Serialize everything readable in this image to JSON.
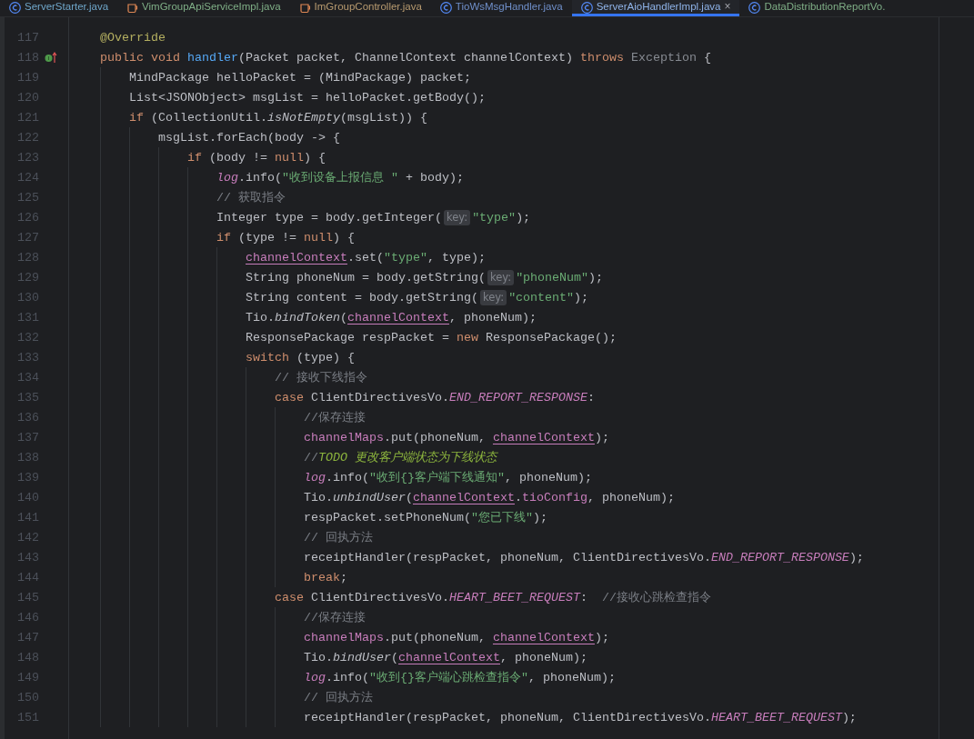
{
  "tabs": [
    {
      "label": "ServerStarter.java",
      "kind": "class",
      "color": "#6fa6c9",
      "selected": false
    },
    {
      "label": "VimGroupApiServiceImpl.java",
      "kind": "bean",
      "color": "#7fae86",
      "selected": false
    },
    {
      "label": "ImGroupController.java",
      "kind": "bean",
      "color": "#b79a6f",
      "selected": false
    },
    {
      "label": "TioWsMsgHandler.java",
      "kind": "class",
      "color": "#6f8fc9",
      "selected": false
    },
    {
      "label": "ServerAioHandlerImpl.java",
      "kind": "class",
      "color": "#8fb3e8",
      "selected": true,
      "close": "×"
    },
    {
      "label": "DataDistributionReportVo.",
      "kind": "class",
      "color": "#7fae86",
      "selected": false
    }
  ],
  "lines": [
    {
      "number": "117",
      "tokens": [
        {
          "kind": "a",
          "text": "@Override"
        }
      ]
    },
    {
      "number": "118",
      "marker": {
        "kind": "implements"
      },
      "tokens": [
        {
          "kind": "k",
          "text": "public void "
        },
        {
          "kind": "m",
          "text": "handler"
        },
        {
          "kind": "p",
          "text": "(Packet packet, ChannelContext channelContext) "
        },
        {
          "kind": "k",
          "text": "throws "
        },
        {
          "kind": "d",
          "text": "Exception"
        },
        {
          "kind": "p",
          "text": " {"
        }
      ],
      "children": [
        {
          "number": "119",
          "tokens": [
            {
              "kind": "p",
              "text": "MindPackage helloPacket = (MindPackage) packet;"
            }
          ]
        },
        {
          "number": "120",
          "tokens": [
            {
              "kind": "p",
              "text": "List<JSONObject> msgList = helloPacket.getBody();"
            }
          ]
        },
        {
          "number": "121",
          "tokens": [
            {
              "kind": "k",
              "text": "if "
            },
            {
              "kind": "p",
              "text": "(CollectionUtil."
            },
            {
              "kind": "sm",
              "text": "isNotEmpty"
            },
            {
              "kind": "p",
              "text": "(msgList)) {"
            }
          ],
          "children": [
            {
              "number": "122",
              "tokens": [
                {
                  "kind": "p",
                  "text": "msgList.forEach(body -> {"
                }
              ],
              "children": [
                {
                  "number": "123",
                  "tokens": [
                    {
                      "kind": "k",
                      "text": "if "
                    },
                    {
                      "kind": "p",
                      "text": "(body != "
                    },
                    {
                      "kind": "k",
                      "text": "null"
                    },
                    {
                      "kind": "p",
                      "text": ") {"
                    }
                  ],
                  "children": [
                    {
                      "number": "124",
                      "tokens": [
                        {
                          "kind": "sf",
                          "text": "log"
                        },
                        {
                          "kind": "p",
                          "text": ".info("
                        },
                        {
                          "kind": "s",
                          "text": "\"收到设备上报信息 \""
                        },
                        {
                          "kind": "p",
                          "text": " + body);"
                        }
                      ]
                    },
                    {
                      "number": "125",
                      "tokens": [
                        {
                          "kind": "c",
                          "text": "// 获取指令"
                        }
                      ]
                    },
                    {
                      "number": "126",
                      "tokens": [
                        {
                          "kind": "p",
                          "text": "Integer type = body.getInteger("
                        },
                        {
                          "kind": "h",
                          "text": "key:"
                        },
                        {
                          "kind": "s",
                          "text": "\"type\""
                        },
                        {
                          "kind": "p",
                          "text": ");"
                        }
                      ]
                    },
                    {
                      "number": "127",
                      "tokens": [
                        {
                          "kind": "k",
                          "text": "if "
                        },
                        {
                          "kind": "p",
                          "text": "(type != "
                        },
                        {
                          "kind": "k",
                          "text": "null"
                        },
                        {
                          "kind": "p",
                          "text": ") {"
                        }
                      ],
                      "children": [
                        {
                          "number": "128",
                          "tokens": [
                            {
                              "kind": "u",
                              "text": "channelContext"
                            },
                            {
                              "kind": "p",
                              "text": ".set("
                            },
                            {
                              "kind": "s",
                              "text": "\"type\""
                            },
                            {
                              "kind": "p",
                              "text": ", type);"
                            }
                          ]
                        },
                        {
                          "number": "129",
                          "tokens": [
                            {
                              "kind": "p",
                              "text": "String phoneNum = body.getString("
                            },
                            {
                              "kind": "h",
                              "text": "key:"
                            },
                            {
                              "kind": "s",
                              "text": "\"phoneNum\""
                            },
                            {
                              "kind": "p",
                              "text": ");"
                            }
                          ]
                        },
                        {
                          "number": "130",
                          "tokens": [
                            {
                              "kind": "p",
                              "text": "String content = body.getString("
                            },
                            {
                              "kind": "h",
                              "text": "key:"
                            },
                            {
                              "kind": "s",
                              "text": "\"content\""
                            },
                            {
                              "kind": "p",
                              "text": ");"
                            }
                          ]
                        },
                        {
                          "number": "131",
                          "tokens": [
                            {
                              "kind": "p",
                              "text": "Tio."
                            },
                            {
                              "kind": "sm",
                              "text": "bindToken"
                            },
                            {
                              "kind": "p",
                              "text": "("
                            },
                            {
                              "kind": "u",
                              "text": "channelContext"
                            },
                            {
                              "kind": "p",
                              "text": ", phoneNum);"
                            }
                          ]
                        },
                        {
                          "number": "132",
                          "tokens": [
                            {
                              "kind": "p",
                              "text": "ResponsePackage respPacket = "
                            },
                            {
                              "kind": "k",
                              "text": "new "
                            },
                            {
                              "kind": "p",
                              "text": "ResponsePackage();"
                            }
                          ]
                        },
                        {
                          "number": "133",
                          "tokens": [
                            {
                              "kind": "k",
                              "text": "switch "
                            },
                            {
                              "kind": "p",
                              "text": "(type) {"
                            }
                          ],
                          "children": [
                            {
                              "number": "134",
                              "tokens": [
                                {
                                  "kind": "c",
                                  "text": "// 接收下线指令"
                                }
                              ]
                            },
                            {
                              "number": "135",
                              "tokens": [
                                {
                                  "kind": "k",
                                  "text": "case "
                                },
                                {
                                  "kind": "p",
                                  "text": "ClientDirectivesVo."
                                },
                                {
                                  "kind": "sf",
                                  "text": "END_REPORT_RESPONSE"
                                },
                                {
                                  "kind": "p",
                                  "text": ":"
                                }
                              ],
                              "children": [
                                {
                                  "number": "136",
                                  "tokens": [
                                    {
                                      "kind": "c",
                                      "text": "//保存连接"
                                    }
                                  ]
                                },
                                {
                                  "number": "137",
                                  "tokens": [
                                    {
                                      "kind": "f",
                                      "text": "channelMaps"
                                    },
                                    {
                                      "kind": "p",
                                      "text": ".put(phoneNum, "
                                    },
                                    {
                                      "kind": "u",
                                      "text": "channelContext"
                                    },
                                    {
                                      "kind": "p",
                                      "text": ");"
                                    }
                                  ]
                                },
                                {
                                  "number": "138",
                                  "tokens": [
                                    {
                                      "kind": "c",
                                      "text": "//"
                                    },
                                    {
                                      "kind": "t",
                                      "text": "TODO 更改客户端状态为下线状态"
                                    }
                                  ]
                                },
                                {
                                  "number": "139",
                                  "tokens": [
                                    {
                                      "kind": "sf",
                                      "text": "log"
                                    },
                                    {
                                      "kind": "p",
                                      "text": ".info("
                                    },
                                    {
                                      "kind": "s",
                                      "text": "\"收到{}客户端下线通知\""
                                    },
                                    {
                                      "kind": "p",
                                      "text": ", phoneNum);"
                                    }
                                  ]
                                },
                                {
                                  "number": "140",
                                  "tokens": [
                                    {
                                      "kind": "p",
                                      "text": "Tio."
                                    },
                                    {
                                      "kind": "sm",
                                      "text": "unbindUser"
                                    },
                                    {
                                      "kind": "p",
                                      "text": "("
                                    },
                                    {
                                      "kind": "u",
                                      "text": "channelContext"
                                    },
                                    {
                                      "kind": "p",
                                      "text": "."
                                    },
                                    {
                                      "kind": "f",
                                      "text": "tioConfig"
                                    },
                                    {
                                      "kind": "p",
                                      "text": ", phoneNum);"
                                    }
                                  ]
                                },
                                {
                                  "number": "141",
                                  "tokens": [
                                    {
                                      "kind": "p",
                                      "text": "respPacket.setPhoneNum("
                                    },
                                    {
                                      "kind": "s",
                                      "text": "\"您已下线\""
                                    },
                                    {
                                      "kind": "p",
                                      "text": ");"
                                    }
                                  ]
                                },
                                {
                                  "number": "142",
                                  "tokens": [
                                    {
                                      "kind": "c",
                                      "text": "// 回执方法"
                                    }
                                  ]
                                },
                                {
                                  "number": "143",
                                  "tokens": [
                                    {
                                      "kind": "p",
                                      "text": "receiptHandler(respPacket, phoneNum, ClientDirectivesVo."
                                    },
                                    {
                                      "kind": "sf",
                                      "text": "END_REPORT_RESPONSE"
                                    },
                                    {
                                      "kind": "p",
                                      "text": ");"
                                    }
                                  ]
                                },
                                {
                                  "number": "144",
                                  "tokens": [
                                    {
                                      "kind": "k",
                                      "text": "break"
                                    },
                                    {
                                      "kind": "p",
                                      "text": ";"
                                    }
                                  ]
                                }
                              ]
                            },
                            {
                              "number": "145",
                              "tokens": [
                                {
                                  "kind": "k",
                                  "text": "case "
                                },
                                {
                                  "kind": "p",
                                  "text": "ClientDirectivesVo."
                                },
                                {
                                  "kind": "sf",
                                  "text": "HEART_BEET_REQUEST"
                                },
                                {
                                  "kind": "p",
                                  "text": ":  "
                                },
                                {
                                  "kind": "c",
                                  "text": "//接收心跳检查指令"
                                }
                              ],
                              "children": [
                                {
                                  "number": "146",
                                  "tokens": [
                                    {
                                      "kind": "c",
                                      "text": "//保存连接"
                                    }
                                  ]
                                },
                                {
                                  "number": "147",
                                  "tokens": [
                                    {
                                      "kind": "f",
                                      "text": "channelMaps"
                                    },
                                    {
                                      "kind": "p",
                                      "text": ".put(phoneNum, "
                                    },
                                    {
                                      "kind": "u",
                                      "text": "channelContext"
                                    },
                                    {
                                      "kind": "p",
                                      "text": ");"
                                    }
                                  ]
                                },
                                {
                                  "number": "148",
                                  "tokens": [
                                    {
                                      "kind": "p",
                                      "text": "Tio."
                                    },
                                    {
                                      "kind": "sm",
                                      "text": "bindUser"
                                    },
                                    {
                                      "kind": "p",
                                      "text": "("
                                    },
                                    {
                                      "kind": "u",
                                      "text": "channelContext"
                                    },
                                    {
                                      "kind": "p",
                                      "text": ", phoneNum);"
                                    }
                                  ]
                                },
                                {
                                  "number": "149",
                                  "tokens": [
                                    {
                                      "kind": "sf",
                                      "text": "log"
                                    },
                                    {
                                      "kind": "p",
                                      "text": ".info("
                                    },
                                    {
                                      "kind": "s",
                                      "text": "\"收到{}客户端心跳检查指令\""
                                    },
                                    {
                                      "kind": "p",
                                      "text": ", phoneNum);"
                                    }
                                  ]
                                },
                                {
                                  "number": "150",
                                  "tokens": [
                                    {
                                      "kind": "c",
                                      "text": "// 回执方法"
                                    }
                                  ]
                                },
                                {
                                  "number": "151",
                                  "tokens": [
                                    {
                                      "kind": "p",
                                      "text": "receiptHandler(respPacket, phoneNum, ClientDirectivesVo."
                                    },
                                    {
                                      "kind": "sf",
                                      "text": "HEART_BEET_REQUEST"
                                    },
                                    {
                                      "kind": "p",
                                      "text": ");"
                                    }
                                  ]
                                }
                              ]
                            }
                          ]
                        }
                      ]
                    }
                  ]
                }
              ]
            }
          ]
        }
      ]
    }
  ]
}
